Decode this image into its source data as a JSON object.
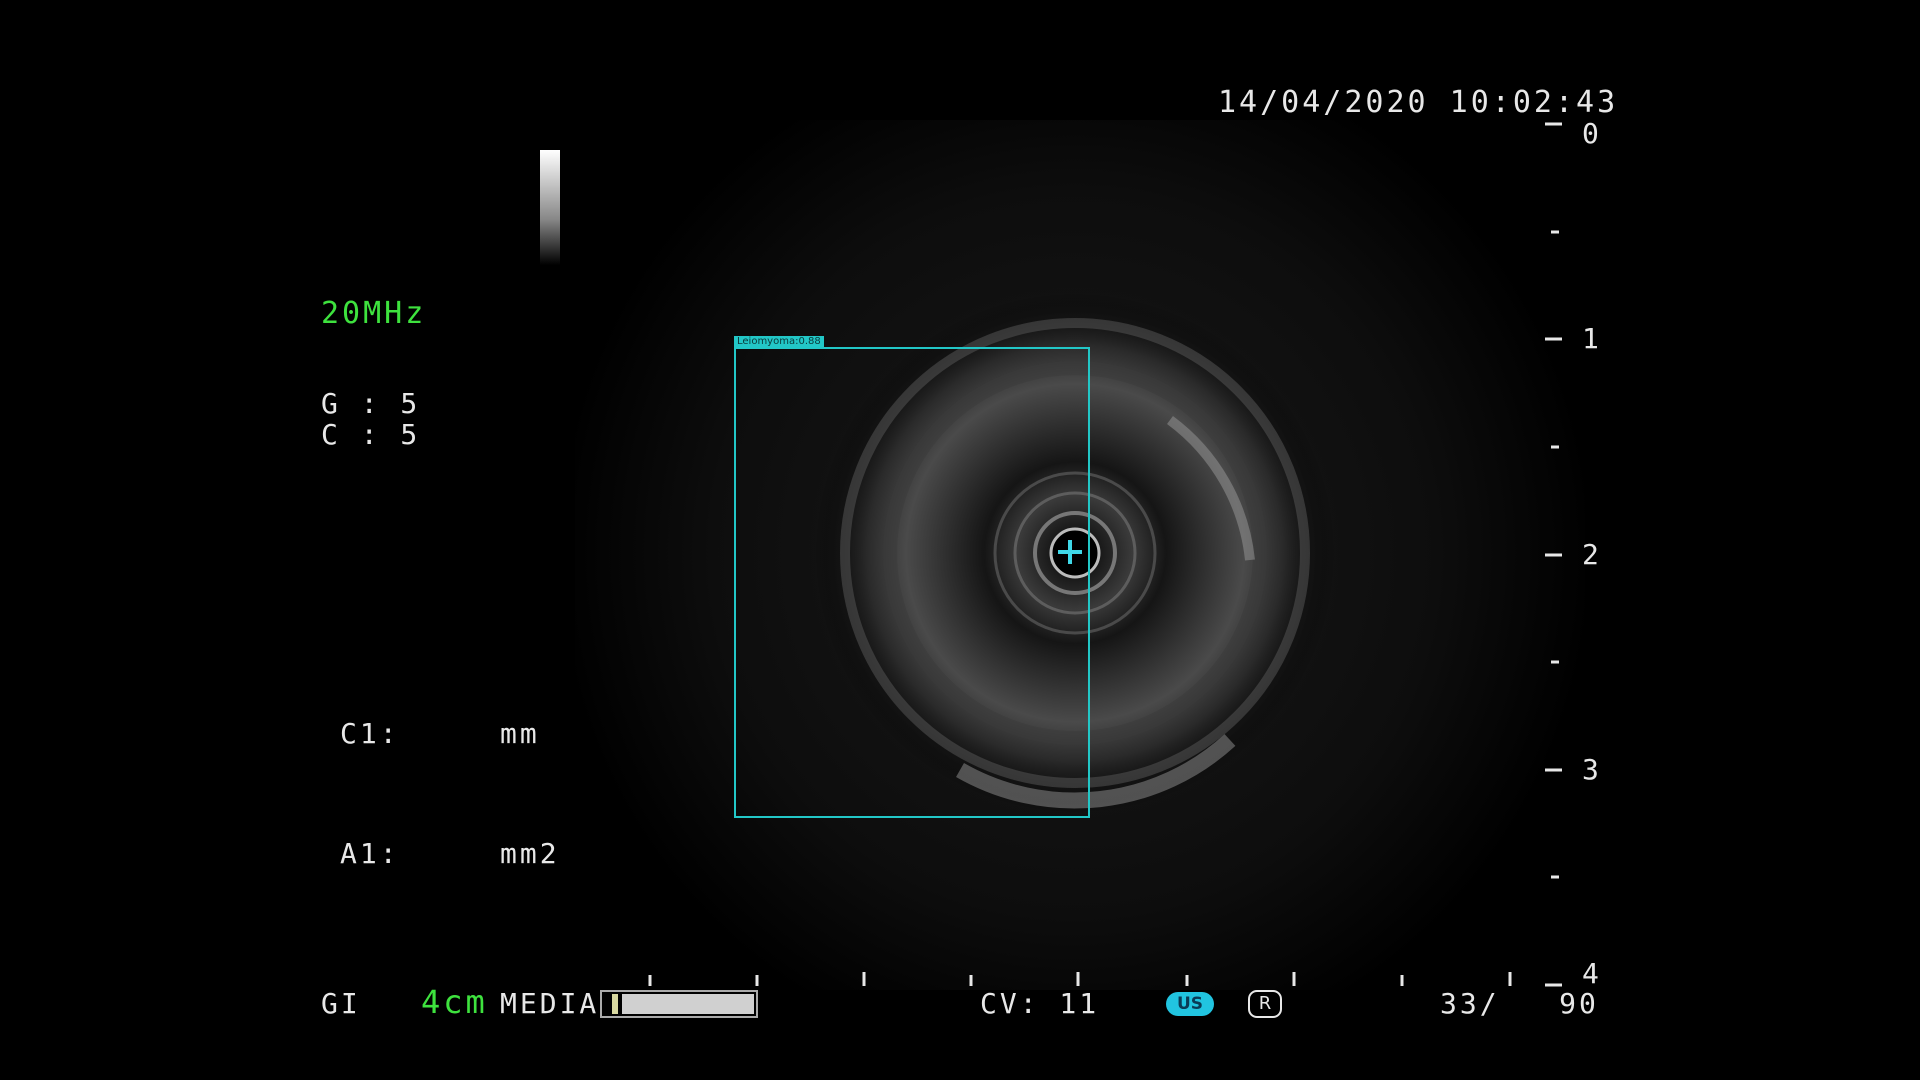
{
  "header": {
    "timestamp": "14/04/2020 10:02:43"
  },
  "settings": {
    "frequency": "20MHz",
    "gain": "G : 5",
    "contrast": "C : 5"
  },
  "measurements": {
    "c1_label": "C1:",
    "c1_unit": "mm",
    "a1_label": "A1:",
    "a1_unit": "mm2"
  },
  "footer": {
    "mode": "GI",
    "depth_range": "4cm",
    "media_label": "MEDIA",
    "cv": "CV: 11",
    "us_badge": "US",
    "r_badge": "R",
    "frame_counter": "33/   90"
  },
  "depth_scale": {
    "labels": [
      "0",
      "1",
      "2",
      "3",
      "4"
    ]
  },
  "detection": {
    "label": "Leiomyoma:0.88",
    "color": "#22c7c7"
  },
  "colors": {
    "text": "#e8e8e8",
    "accent_green": "#3ee23e",
    "detection_box": "#22c7c7",
    "us_badge": "#21c4e0"
  }
}
